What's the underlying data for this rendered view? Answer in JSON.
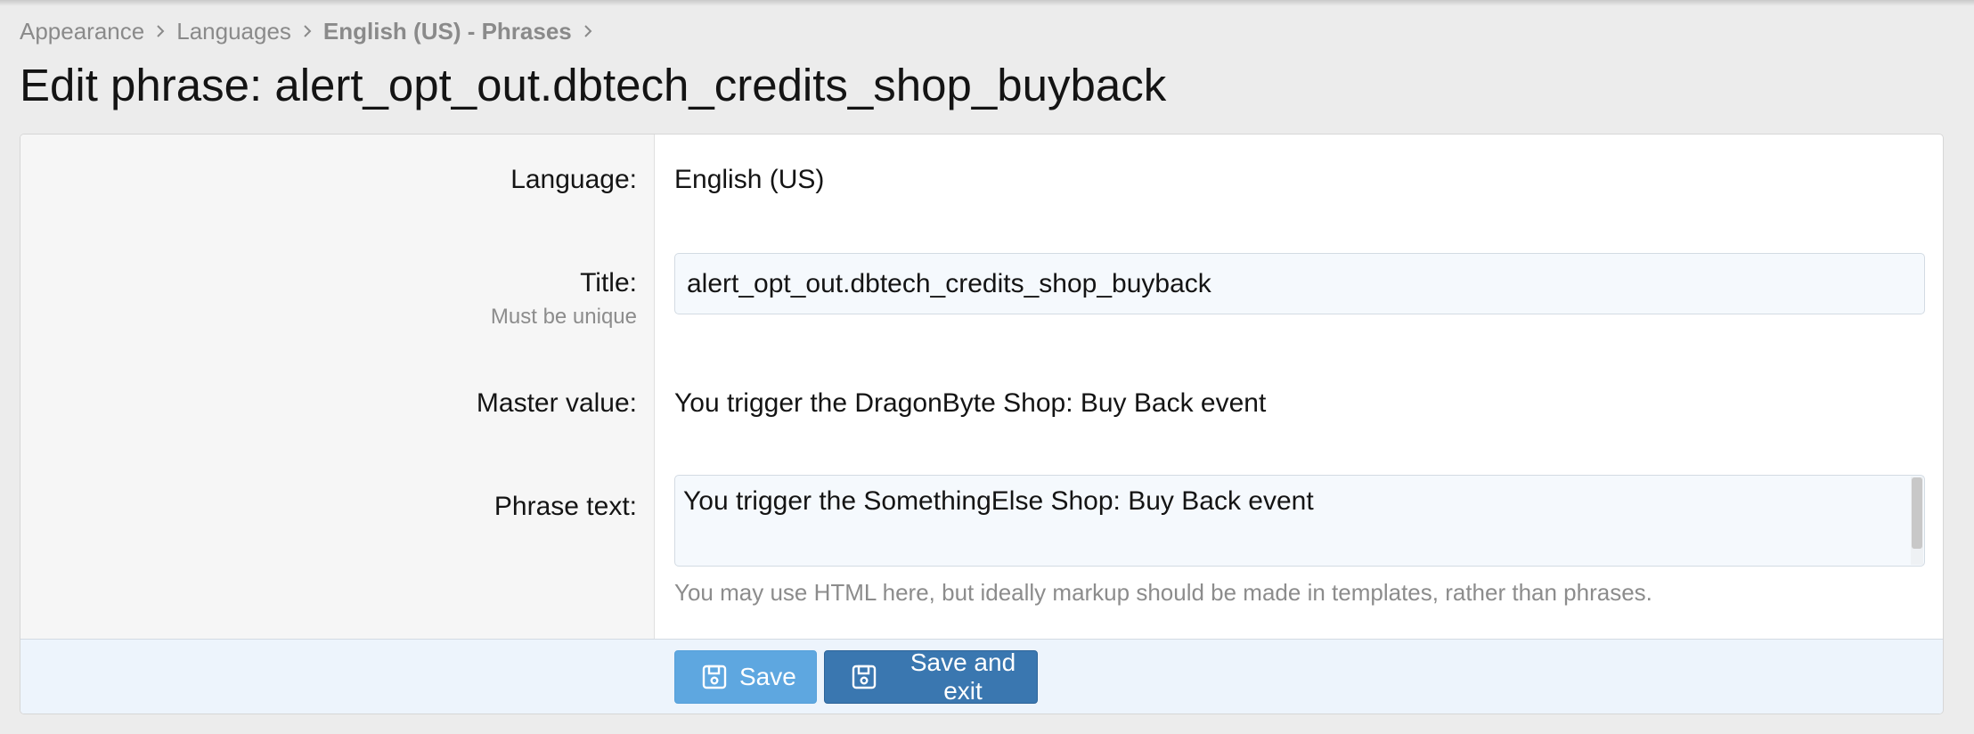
{
  "breadcrumb": {
    "items": [
      {
        "label": "Appearance"
      },
      {
        "label": "Languages"
      },
      {
        "label": "English (US) - Phrases"
      }
    ]
  },
  "page": {
    "title": "Edit phrase: alert_opt_out.dbtech_credits_shop_buyback"
  },
  "form": {
    "language": {
      "label": "Language:",
      "value": "English (US)"
    },
    "title": {
      "label": "Title:",
      "hint": "Must be unique",
      "value": "alert_opt_out.dbtech_credits_shop_buyback"
    },
    "master_value": {
      "label": "Master value:",
      "value": "You trigger the DragonByte Shop: Buy Back event"
    },
    "phrase_text": {
      "label": "Phrase text:",
      "value": "You trigger the SomethingElse Shop: Buy Back event",
      "explain": "You may use HTML here, but ideally markup should be made in templates, rather than phrases."
    }
  },
  "buttons": {
    "save": {
      "label": "Save",
      "icon": "save-icon"
    },
    "save_exit": {
      "label": "Save and exit",
      "icon": "save-icon"
    }
  },
  "colors": {
    "save_button": "#5ea7e0",
    "save_exit_button": "#3a77b0",
    "footer_bg": "#edf4fc",
    "input_bg": "#f5f9fd"
  }
}
